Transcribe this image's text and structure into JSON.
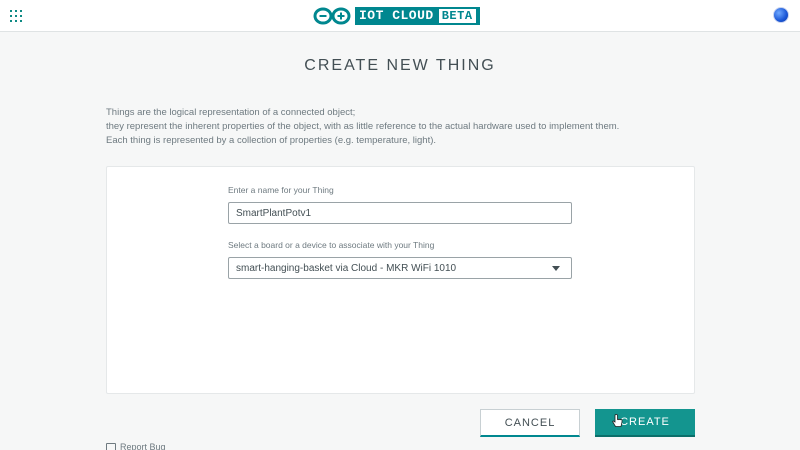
{
  "header": {
    "logo_text": "IOT CLOUD",
    "logo_badge": "BETA"
  },
  "page": {
    "title": "CREATE NEW THING",
    "intro": [
      "Things are the logical representation of a connected object;",
      "they represent the inherent properties of the object, with as little reference to the actual hardware used to implement them.",
      "Each thing is represented by a collection of properties (e.g. temperature, light)."
    ]
  },
  "form": {
    "name_label": "Enter a name for your Thing",
    "name_value": "SmartPlantPotv1",
    "board_label": "Select a board or a device to associate with your Thing",
    "board_selected": "smart-hanging-basket via Cloud - MKR WiFi 1010"
  },
  "actions": {
    "cancel_label": "CANCEL",
    "create_label": "CREATE"
  },
  "footer": {
    "report_bug_label": "Report Bug"
  },
  "icons": {
    "apps": "apps-grid-icon",
    "logo": "arduino-infinity-logo-icon",
    "avatar": "user-avatar",
    "dropdown": "caret-down-icon",
    "cursor": "hand-pointer-icon",
    "bug": "bug-report-icon"
  },
  "colors": {
    "brand_teal": "#00878f",
    "create_button": "#13958f",
    "background": "#f6f7f7"
  }
}
